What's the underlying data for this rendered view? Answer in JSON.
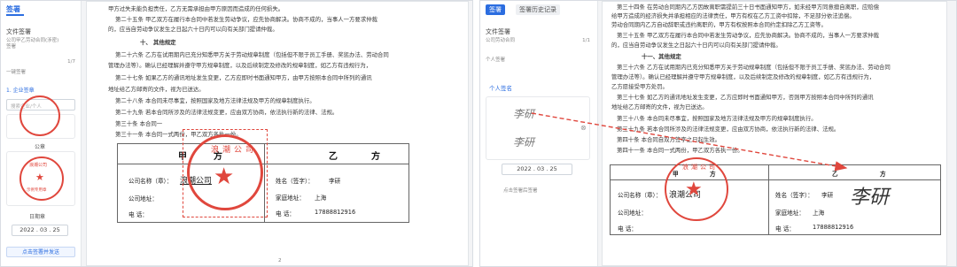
{
  "left": {
    "sidebar": {
      "title": "签署",
      "file_section": "文件签署",
      "file_note": "公司甲乙劳动合同(涉密)",
      "file_note_2": "签署",
      "count": "1/7",
      "add_label": "一键签署",
      "step_label": "1. 企业签章",
      "search_placeholder": "搜索企业/个人",
      "seal_label_1": "公章",
      "seal_label_2": "合同章",
      "seal_stamp_text": "浪潮公司",
      "seal_stamp_sub": "示例专用章",
      "date_label": "日期章",
      "date_value": "2022 . 03 . 25",
      "bottom_button": "点击签署并发送"
    },
    "doc": {
      "lines": [
        "甲方过失未能负担责任，乙方无需承担由甲方原因而造成的任何损失。",
        "第二十五条 甲乙双方在履行本合同中若发生劳动争议，应先协商解决。协商不成的，当事人一方要求仲裁",
        "的，应当自劳动争议发生之日起六十日内可以向有关部门提请仲裁。",
        "十、 其他规定",
        "第二十六条 乙方在试用期内已充分知悉甲方关于劳动规章制度（包括但不限于员工手册、奖惩办法、劳动合同",
        "管理办法等）。确认已经理解并遵守甲方规章制度，以及后续制定及修改的规章制度，如乙方有违规行为，",
        "第二十七条 如果乙方的通讯地址发生变更，乙方应即时书面通知甲方，由甲方按照本合同中所列的通讯",
        "地址给乙方邮寄的文件，视为已送达。",
        "第二十八条 本合同未尽事宜，按照国家及地方法律法规及甲方的规章制度执行。",
        "第二十九条 若本合同所涉及的法律法规变更，应由双方协商，依法执行新的法律、法规。",
        "第三十条 本合同一",
        "第三十一条 本合同一式两份，甲乙双方各执一份。"
      ],
      "party_a_header": "甲",
      "party_a_header_2": "方",
      "party_b_header": "乙",
      "party_b_header_2": "方",
      "company_label": "公司名称（章）：",
      "company_value": "浪潮公司",
      "address_label": "公司地址：",
      "phone_label": "电  话：",
      "name_label": "姓名（签字）：",
      "name_value": "李研",
      "home_label": "家庭地址：",
      "home_value": "上海",
      "phone_b_label": "电  话：",
      "phone_b_value": "17888812916",
      "contract_title_pre": "第三十条 本合同一",
      "stamp_text": "浪潮公司",
      "page_number": "2"
    }
  },
  "right": {
    "tabs": [
      "签署",
      "签署历史记录"
    ],
    "sidebar": {
      "file_section": "文件签署",
      "file_note": "公司劳动合同",
      "count": "1/1",
      "person_label": "个人签署",
      "personal_sign": "个人签名",
      "signature_1": "李研",
      "signature_2": "李研",
      "date_value": "2022 . 03 . 25",
      "bottom_link": "点击签署后签署"
    },
    "doc": {
      "lines": [
        "第三十四条 在劳动合同期内乙方因故离职需提前三十日书面通知甲方，如未经甲方同意擅自离职，应赔偿",
        "给甲方造成的经济损失并承担相应的法律责任，甲方有权在乙方工资中扣除，不足部分依法追偿。",
        "劳动合同期内乙方自动辞职或违约离职的，甲方有权按照本合同约定扣除乙方工资等。",
        "第三十五条 甲乙双方在履行本合同中若发生劳动争议，应先协商解决。协商不成的，当事人一方要求仲裁",
        "的，应当自劳动争议发生之日起六十日内可以向有关部门提请仲裁。",
        "十一、其他规定",
        "第三十六条 乙方在试用期内已充分知悉甲方关于劳动规章制度（包括但不限于员工手册、奖惩办法、劳动合同",
        "管理办法等）。确认已经理解并遵守甲方规章制度，以及后续制定及修改的规章制度，如乙方有违规行为，",
        "乙方愿接受甲方处罚。",
        "第三十七条 如乙方的通讯地址发生变更，乙方应即时书面通知甲方，否则甲方按照本合同中所列的通讯",
        "地址给乙方邮寄的文件，视为已送达。",
        "第三十八条 本合同未尽事宜，按照国家及地方法律法规及甲方的规章制度执行。",
        "第三十九条 若本合同所涉及的法律法规变更，应由双方协商，依法执行新的法律、法规。",
        "第四十条 本合同自双方签字之日起生效。",
        "第四十一条 本合同一式两份，甲乙双方各执一份。"
      ],
      "party_a_header": "甲",
      "party_a_header_2": "方",
      "party_b_header": "乙",
      "party_b_header_2": "方",
      "company_label": "公司名称（章）：",
      "company_value": "浪潮公司",
      "address_label": "公司地址：",
      "phone_label": "电  话：",
      "name_label": "姓名（签字）：",
      "name_value": "李研",
      "signature": "李研",
      "home_label": "家庭地址：",
      "home_value": "上海",
      "phone_b_label": "电  话：",
      "phone_b_value": "17888812916",
      "stamp_text": "浪潮公司"
    }
  },
  "colors": {
    "accent": "#2b6de0",
    "stamp_red": "#e0473d",
    "arrow_red": "#e0473d"
  }
}
